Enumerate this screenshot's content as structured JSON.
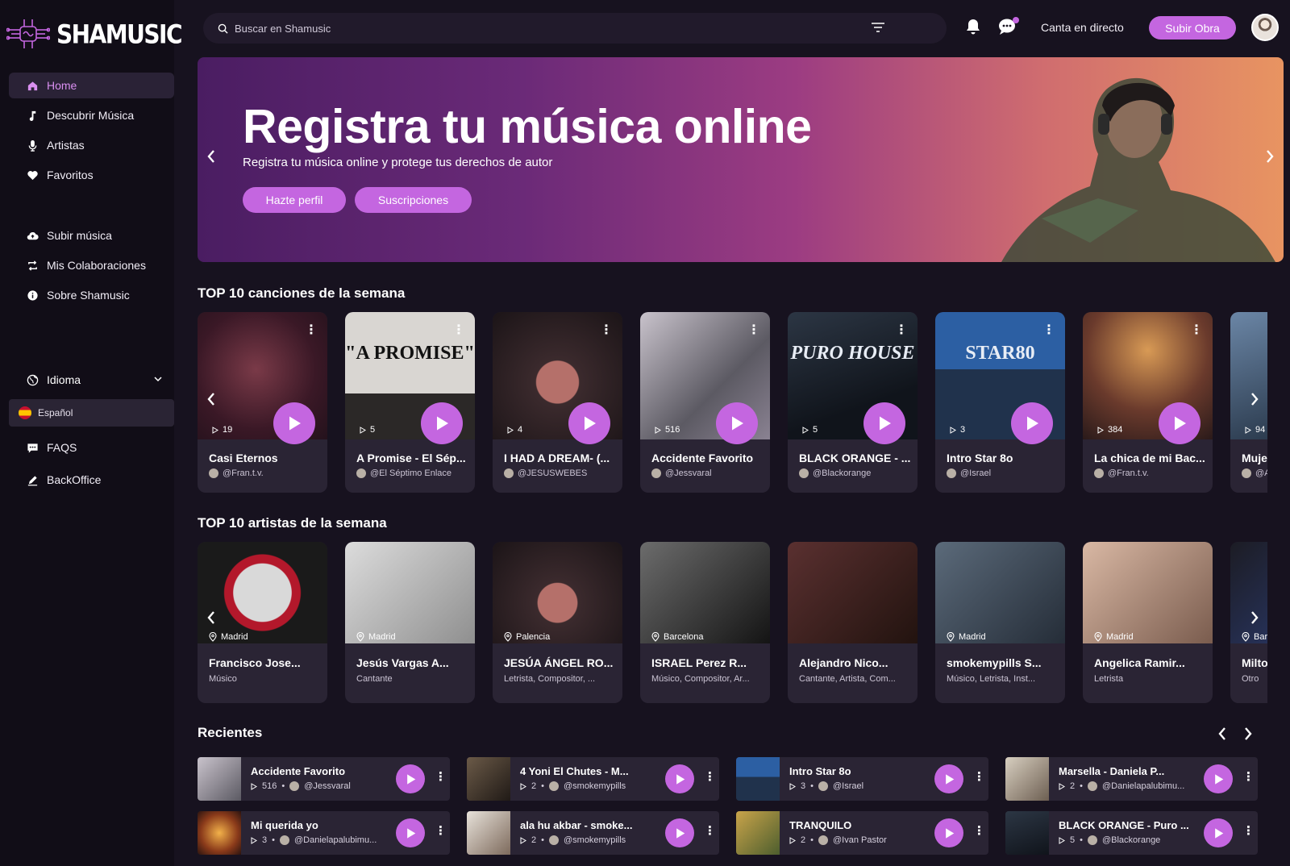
{
  "app": {
    "name": "SHAMUSIC",
    "accent": "#c466e0",
    "background": "#17121f"
  },
  "sidebar": {
    "items": [
      {
        "label": "Home",
        "icon": "home-icon",
        "active": true
      },
      {
        "label": "Descubrir Música",
        "icon": "music-note-icon"
      },
      {
        "label": "Artistas",
        "icon": "microphone-icon"
      },
      {
        "label": "Favoritos",
        "icon": "heart-icon"
      },
      {
        "label": "Subir música",
        "icon": "cloud-upload-icon"
      },
      {
        "label": "Mis Colaboraciones",
        "icon": "repeat-icon"
      },
      {
        "label": "Sobre Shamusic",
        "icon": "info-icon"
      }
    ],
    "language_label": "Idioma",
    "language_option": "Español",
    "faqs": "FAQS",
    "backoffice": "BackOffice"
  },
  "topbar": {
    "search_placeholder": "Buscar en Shamusic",
    "live_link": "Canta en directo",
    "upload_button": "Subir Obra"
  },
  "hero": {
    "title": "Registra tu música online",
    "subtitle": "Registra tu música online y protege tus derechos de autor",
    "button_profile": "Hazte perfil",
    "button_subscriptions": "Suscripciones"
  },
  "top_songs": {
    "title": "TOP 10 canciones de la semana",
    "items": [
      {
        "title": "Casi Eternos",
        "plays": "19",
        "user": "@Fran.t.v."
      },
      {
        "title": "A Promise - El Sép...",
        "plays": "5",
        "user": "@El Séptimo Enlace",
        "cover_text": "\"A PROMISE\""
      },
      {
        "title": "I HAD A DREAM- (...",
        "plays": "4",
        "user": "@JESUSWEBES"
      },
      {
        "title": "Accidente Favorito",
        "plays": "516",
        "user": "@Jessvaral"
      },
      {
        "title": "BLACK ORANGE - ...",
        "plays": "5",
        "user": "@Blackorange",
        "cover_text": "PURO HOUSE"
      },
      {
        "title": "Intro Star 8o",
        "plays": "3",
        "user": "@Israel",
        "cover_text": "STAR80"
      },
      {
        "title": "La chica de mi Bac...",
        "plays": "384",
        "user": "@Fran.t.v."
      },
      {
        "title": "Mujer",
        "plays": "94",
        "user": "@Ar"
      }
    ]
  },
  "top_artists": {
    "title": "TOP 10 artistas de la semana",
    "items": [
      {
        "name": "Francisco Jose...",
        "location": "Madrid",
        "role": "Músico"
      },
      {
        "name": "Jesús Vargas A...",
        "location": "Madrid",
        "role": "Cantante"
      },
      {
        "name": "JESÚA ÁNGEL RO...",
        "location": "Palencia",
        "role": "Letrista, Compositor, ..."
      },
      {
        "name": "ISRAEL Perez R...",
        "location": "Barcelona",
        "role": "Músico, Compositor, Ar..."
      },
      {
        "name": "Alejandro Nico...",
        "location": "",
        "role": "Cantante, Artista, Com..."
      },
      {
        "name": "smokemypills S...",
        "location": "Madrid",
        "role": "Músico, Letrista, Inst..."
      },
      {
        "name": "Angelica Ramir...",
        "location": "Madrid",
        "role": "Letrista"
      },
      {
        "name": "Miltor",
        "location": "Barc",
        "role": "Otro"
      }
    ]
  },
  "recent": {
    "title": "Recientes",
    "items": [
      {
        "title": "Accidente Favorito",
        "plays": "516",
        "user": "@Jessvaral"
      },
      {
        "title": "4 Yoni El Chutes - M...",
        "plays": "2",
        "user": "@smokemypills"
      },
      {
        "title": "Intro Star 8o",
        "plays": "3",
        "user": "@Israel"
      },
      {
        "title": "Marsella - Daniela P...",
        "plays": "2",
        "user": "@Danielapalubimu..."
      },
      {
        "title": "Mi querida yo",
        "plays": "3",
        "user": "@Danielapalubimu..."
      },
      {
        "title": "ala hu akbar - smoke...",
        "plays": "2",
        "user": "@smokemypills"
      },
      {
        "title": "TRANQUILO",
        "plays": "2",
        "user": "@Ivan Pastor"
      },
      {
        "title": "BLACK ORANGE - Puro ...",
        "plays": "5",
        "user": "@Blackorange"
      }
    ]
  }
}
